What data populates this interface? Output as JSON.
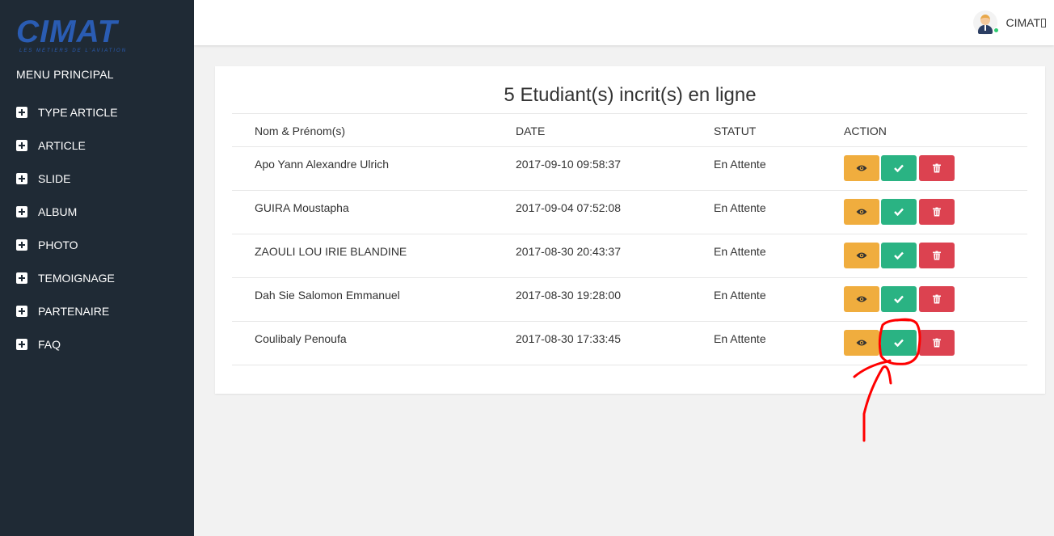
{
  "brand": {
    "logo_text": "CIMAT",
    "logo_tagline": "LES METIERS DE L'AVIATION"
  },
  "sidebar": {
    "title": "MENU PRINCIPAL",
    "items": [
      {
        "label": "TYPE ARTICLE"
      },
      {
        "label": "ARTICLE"
      },
      {
        "label": "SLIDE"
      },
      {
        "label": "ALBUM"
      },
      {
        "label": "PHOTO"
      },
      {
        "label": "TEMOIGNAGE"
      },
      {
        "label": "PARTENAIRE"
      },
      {
        "label": "FAQ"
      }
    ]
  },
  "header": {
    "user_name": "CIMAT"
  },
  "main": {
    "title": "5 Etudiant(s) incrit(s) en ligne",
    "columns": [
      "Nom & Prénom(s)",
      "DATE",
      "STATUT",
      "ACTION"
    ],
    "rows": [
      {
        "name": "Apo Yann Alexandre Ulrich",
        "date": "2017-09-10 09:58:37",
        "status": "En Attente"
      },
      {
        "name": "GUIRA Moustapha",
        "date": "2017-09-04 07:52:08",
        "status": "En Attente"
      },
      {
        "name": "ZAOULI LOU IRIE BLANDINE",
        "date": "2017-08-30 20:43:37",
        "status": "En Attente"
      },
      {
        "name": "Dah Sie Salomon Emmanuel",
        "date": "2017-08-30 19:28:00",
        "status": "En Attente"
      },
      {
        "name": "Coulibaly Penoufa",
        "date": "2017-08-30 17:33:45",
        "status": "En Attente"
      }
    ],
    "actions": [
      "eye-icon",
      "check-icon",
      "trash-icon"
    ]
  },
  "colors": {
    "sidebar_bg": "#1f2a35",
    "view_button": "#f0ad3e",
    "validate_button": "#2ab383",
    "delete_button": "#dc4250",
    "annotation": "#ff0000"
  }
}
